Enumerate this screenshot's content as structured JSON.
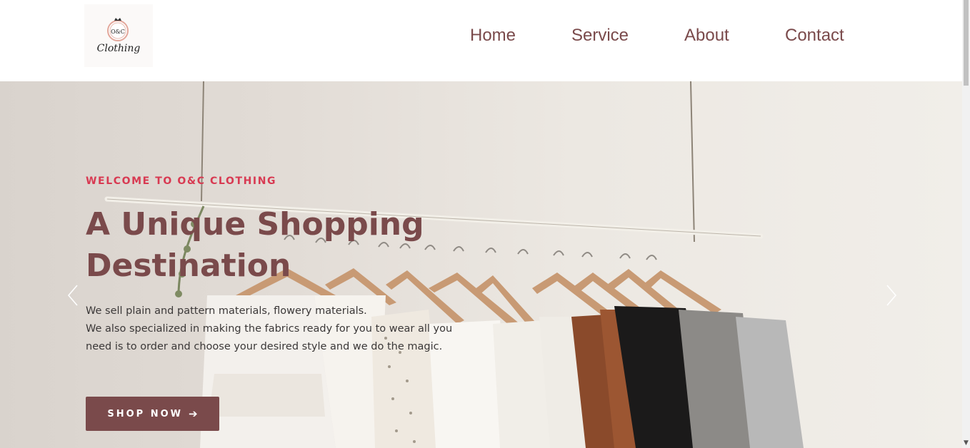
{
  "header": {
    "logo": {
      "monogram": "O&C",
      "script": "Clothing"
    },
    "nav": [
      {
        "label": "Home"
      },
      {
        "label": "Service"
      },
      {
        "label": "About"
      },
      {
        "label": "Contact"
      }
    ]
  },
  "hero": {
    "eyebrow": "WELCOME TO O&C CLOTHING",
    "headline": "A Unique Shopping Destination",
    "body": [
      "We sell plain and pattern materials, flowery materials.",
      "We also specialized in making the fabrics ready for you to wear all you need is to order and choose your desired style and we do the magic."
    ],
    "cta_label": "SHOP NOW",
    "cta_icon": "arrow-right-icon",
    "prev_icon": "chevron-left-icon",
    "next_icon": "chevron-right-icon"
  },
  "colors": {
    "brand": "#7a4a4b",
    "accent": "#d83a52",
    "text": "#3b3838"
  }
}
